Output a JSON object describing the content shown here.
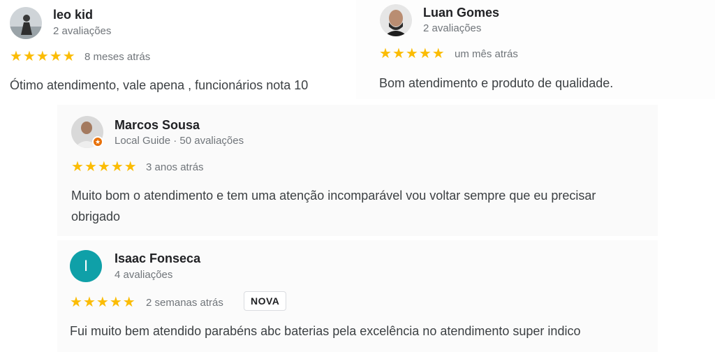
{
  "reviews": [
    {
      "name": "leo kid",
      "meta": "2 avaliações",
      "rating": 5,
      "stars": [
        "★",
        "★",
        "★",
        "★",
        "★"
      ],
      "date": "8 meses atrás",
      "text": "Ótimo atendimento, vale apena , funcionários nota 10"
    },
    {
      "name": "Luan Gomes",
      "meta": "2 avaliações",
      "rating": 5,
      "stars": [
        "★",
        "★",
        "★",
        "★",
        "★"
      ],
      "date": "um mês atrás",
      "text": "Bom atendimento e produto de qualidade."
    },
    {
      "name": "Marcos Sousa",
      "meta": "Local Guide · 50 avaliações",
      "rating": 5,
      "stars": [
        "★",
        "★",
        "★",
        "★",
        "★"
      ],
      "date": "3 anos atrás",
      "text_line1": "Muito bom o atendimento e tem uma atenção incomparável vou voltar sempre que eu precisar",
      "text_line2": "obrigado"
    },
    {
      "name": "Isaac Fonseca",
      "meta": "4 avaliações",
      "avatar_initial": "I",
      "rating": 5,
      "stars": [
        "★",
        "★",
        "★",
        "★",
        "★"
      ],
      "date": "2 semanas atrás",
      "badge": "NOVA",
      "text": "Fui muito bem atendido parabéns abc baterias pela excelência no atendimento super indico"
    }
  ],
  "colors": {
    "star": "#fbbc04",
    "avatar_teal": "#0fa0a8",
    "local_guide_badge": "#e8710a"
  },
  "icons": [
    "avatar-photo",
    "local-guide-badge-icon",
    "star-icon"
  ]
}
